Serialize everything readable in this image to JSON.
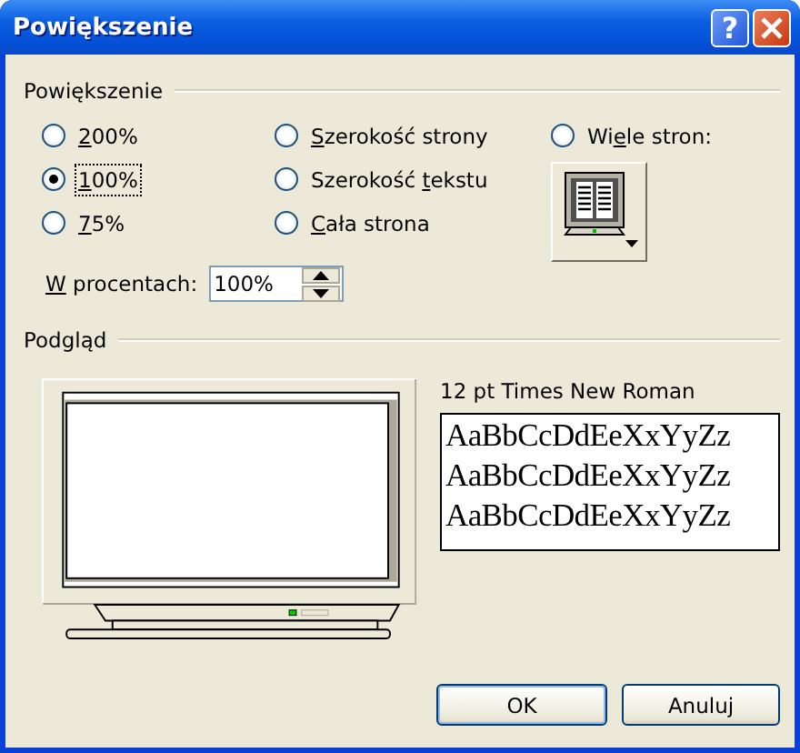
{
  "window": {
    "title": "Powiększenie",
    "buttons": [
      {
        "kind": "help",
        "label": "?"
      },
      {
        "kind": "close"
      }
    ]
  },
  "zoom_group": {
    "title": "Powiększenie",
    "options": [
      {
        "key": "2",
        "after": "00%",
        "selected": false,
        "focused": false
      },
      {
        "key": "1",
        "after": "00%",
        "selected": true,
        "focused": true
      },
      {
        "key": "7",
        "after": "5%",
        "selected": false,
        "focused": false
      },
      {
        "key": "S",
        "after": "zerokość strony",
        "selected": false,
        "focused": false
      },
      {
        "before": "Szerokość ",
        "key": "t",
        "after": "ekstu",
        "selected": false,
        "focused": false
      },
      {
        "key": "C",
        "after": "ała strona",
        "selected": false,
        "focused": false
      },
      {
        "before": "Wi",
        "key": "e",
        "after": "le stron:",
        "selected": false,
        "focused": false
      }
    ],
    "percent": {
      "label_key": "W",
      "label_after": " procentach:",
      "value": "100%"
    }
  },
  "preview_group": {
    "title": "Podgląd",
    "font_label": "12 pt Times New Roman",
    "sample_lines": [
      "AaBbCcDdEeXxYyZz",
      "AaBbCcDdEeXxYyZz",
      "AaBbCcDdEeXxYyZz"
    ]
  },
  "buttons": [
    "OK",
    "Anuluj"
  ]
}
